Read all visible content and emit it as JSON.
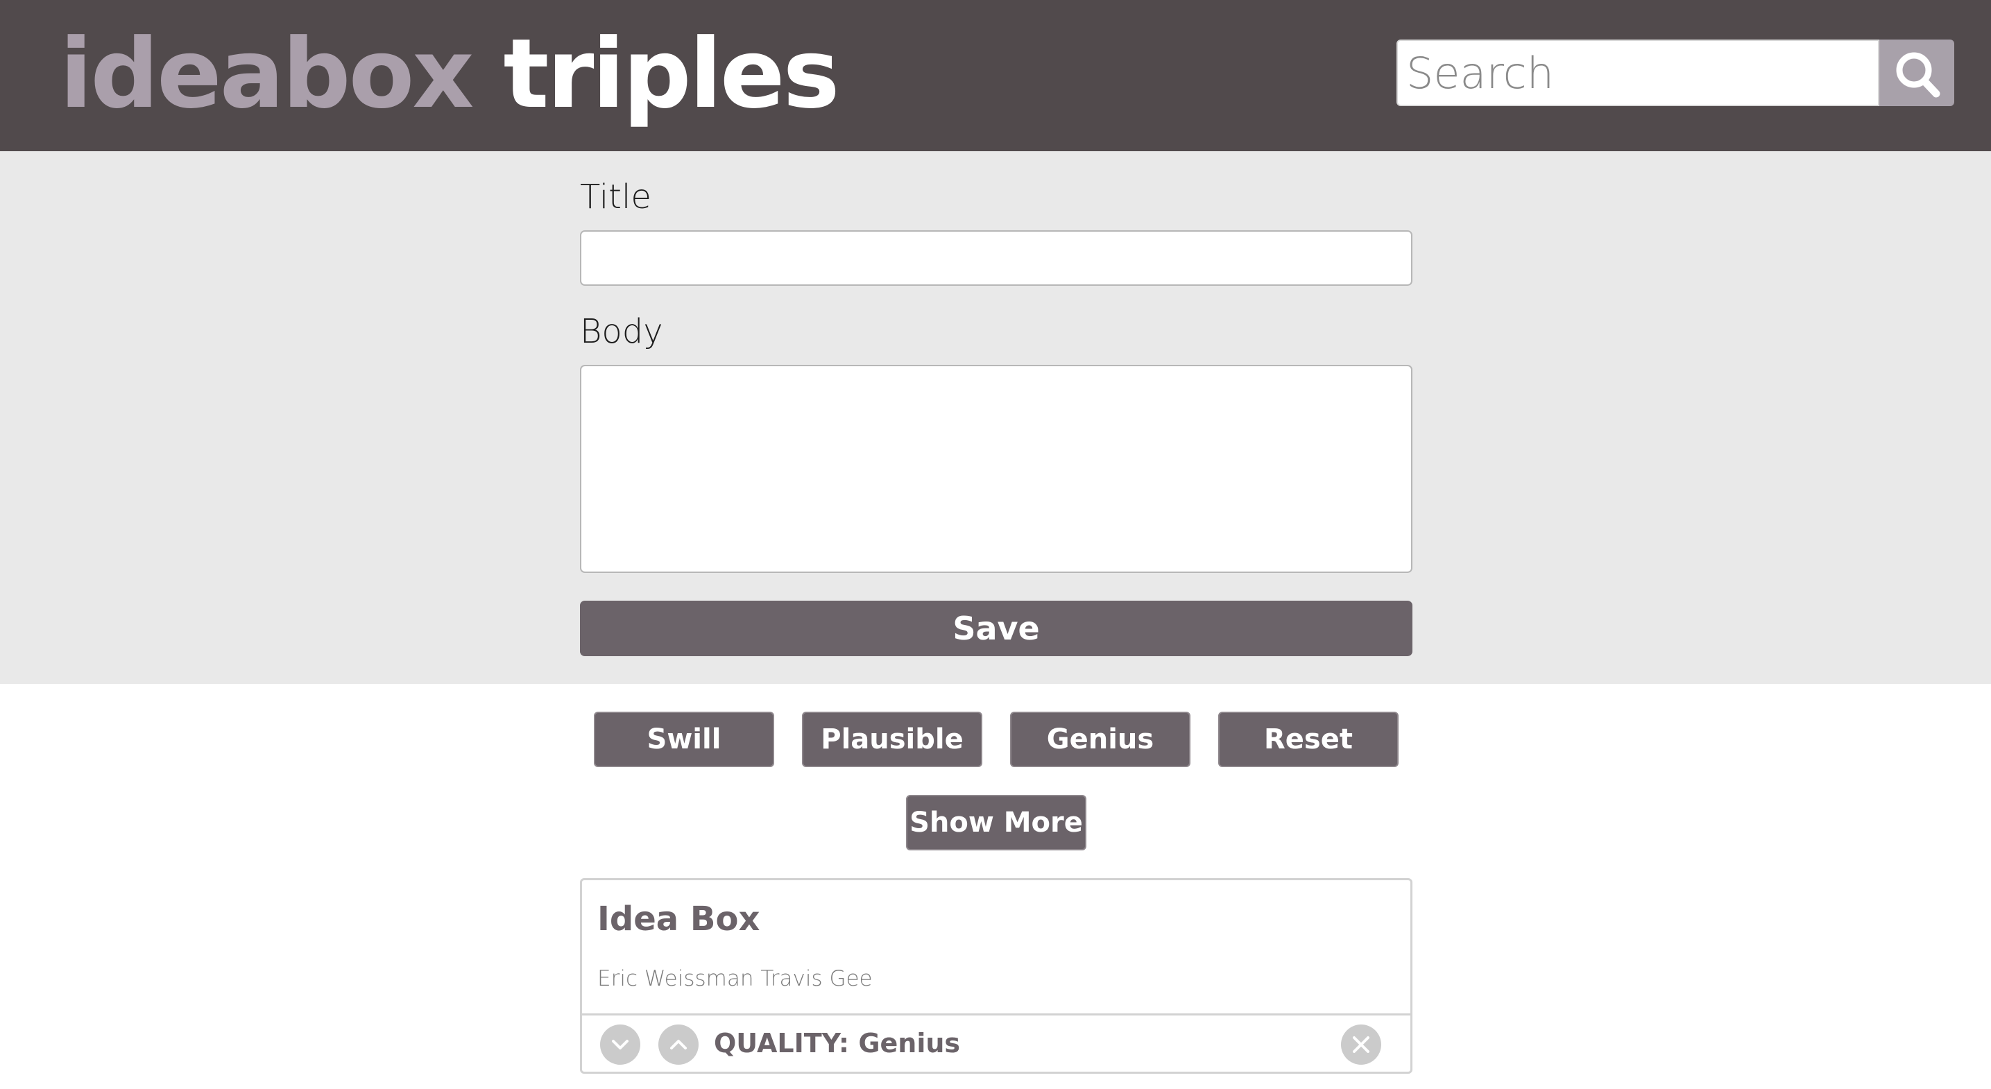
{
  "header": {
    "logo_part1": "ideabox",
    "logo_part2": "triples",
    "search_placeholder": "Search",
    "search_icon": "magnifier-icon"
  },
  "form": {
    "title_label": "Title",
    "title_value": "",
    "body_label": "Body",
    "body_value": "",
    "save_label": "Save"
  },
  "filters": {
    "swill": "Swill",
    "plausible": "Plausible",
    "genius": "Genius",
    "reset": "Reset"
  },
  "show_more_label": "Show More",
  "ideas": [
    {
      "title": "Idea Box",
      "body": "Eric Weissman Travis Gee",
      "quality_label": "QUALITY:",
      "quality_value": "Genius",
      "downvote_icon": "chevron-down-icon",
      "upvote_icon": "chevron-up-icon",
      "delete_icon": "close-icon"
    }
  ],
  "colors": {
    "header_bg": "#514a4c",
    "logo_accent": "#aa9fab",
    "button_bg": "#6b6369",
    "form_bg": "#e9e9e9"
  }
}
